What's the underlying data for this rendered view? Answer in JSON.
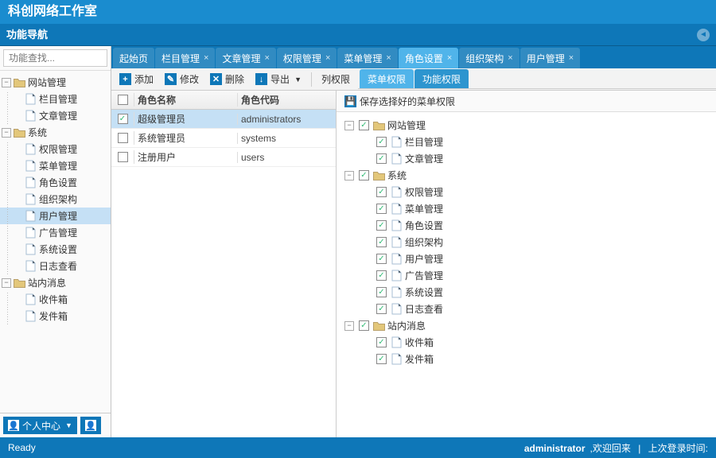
{
  "header": {
    "title": "科创网络工作室"
  },
  "nav": {
    "title": "功能导航"
  },
  "search": {
    "placeholder": "功能查找..."
  },
  "sidebar_tree": [
    {
      "label": "网站管理",
      "type": "folder",
      "expanded": true,
      "level": 0,
      "children_count": 2
    },
    {
      "label": "栏目管理",
      "type": "file",
      "level": 1
    },
    {
      "label": "文章管理",
      "type": "file",
      "level": 1
    },
    {
      "label": "系统",
      "type": "folder",
      "expanded": true,
      "level": 0,
      "children_count": 8
    },
    {
      "label": "权限管理",
      "type": "file",
      "level": 1
    },
    {
      "label": "菜单管理",
      "type": "file",
      "level": 1
    },
    {
      "label": "角色设置",
      "type": "file",
      "level": 1
    },
    {
      "label": "组织架构",
      "type": "file",
      "level": 1
    },
    {
      "label": "用户管理",
      "type": "file",
      "level": 1,
      "selected": true
    },
    {
      "label": "广告管理",
      "type": "file",
      "level": 1
    },
    {
      "label": "系统设置",
      "type": "file",
      "level": 1
    },
    {
      "label": "日志查看",
      "type": "file",
      "level": 1
    },
    {
      "label": "站内消息",
      "type": "folder",
      "expanded": true,
      "level": 0,
      "children_count": 2
    },
    {
      "label": "收件箱",
      "type": "file",
      "level": 1
    },
    {
      "label": "发件箱",
      "type": "file",
      "level": 1
    }
  ],
  "profile_button": "个人中心",
  "tabs": [
    {
      "label": "起始页",
      "closable": false
    },
    {
      "label": "栏目管理",
      "closable": true
    },
    {
      "label": "文章管理",
      "closable": true
    },
    {
      "label": "权限管理",
      "closable": true
    },
    {
      "label": "菜单管理",
      "closable": true
    },
    {
      "label": "角色设置",
      "closable": true,
      "active": true
    },
    {
      "label": "组织架构",
      "closable": true
    },
    {
      "label": "用户管理",
      "closable": true
    }
  ],
  "toolbar": {
    "add": "添加",
    "edit": "修改",
    "delete": "删除",
    "export": "导出",
    "col_perm": "列权限"
  },
  "grid": {
    "col_name": "角色名称",
    "col_code": "角色代码",
    "rows": [
      {
        "name": "超级管理员",
        "code": "administrators",
        "checked": true,
        "selected": true
      },
      {
        "name": "系统管理员",
        "code": "systems",
        "checked": false
      },
      {
        "name": "注册用户",
        "code": "users",
        "checked": false
      }
    ]
  },
  "subtabs": {
    "menu_perm": "菜单权限",
    "func_perm": "功能权限"
  },
  "save_button": "保存选择好的菜单权限",
  "perm_tree": [
    {
      "label": "网站管理",
      "type": "folder",
      "level": 0,
      "expanded": true
    },
    {
      "label": "栏目管理",
      "type": "file",
      "level": 1
    },
    {
      "label": "文章管理",
      "type": "file",
      "level": 1
    },
    {
      "label": "系统",
      "type": "folder",
      "level": 0,
      "expanded": true
    },
    {
      "label": "权限管理",
      "type": "file",
      "level": 1
    },
    {
      "label": "菜单管理",
      "type": "file",
      "level": 1
    },
    {
      "label": "角色设置",
      "type": "file",
      "level": 1
    },
    {
      "label": "组织架构",
      "type": "file",
      "level": 1
    },
    {
      "label": "用户管理",
      "type": "file",
      "level": 1
    },
    {
      "label": "广告管理",
      "type": "file",
      "level": 1
    },
    {
      "label": "系统设置",
      "type": "file",
      "level": 1
    },
    {
      "label": "日志查看",
      "type": "file",
      "level": 1
    },
    {
      "label": "站内消息",
      "type": "folder",
      "level": 0,
      "expanded": true
    },
    {
      "label": "收件箱",
      "type": "file",
      "level": 1
    },
    {
      "label": "发件箱",
      "type": "file",
      "level": 1
    }
  ],
  "status": {
    "ready": "Ready",
    "user": "administrator",
    "welcome": ",欢迎回来",
    "sep": "|",
    "last_login": "上次登录时间:"
  }
}
